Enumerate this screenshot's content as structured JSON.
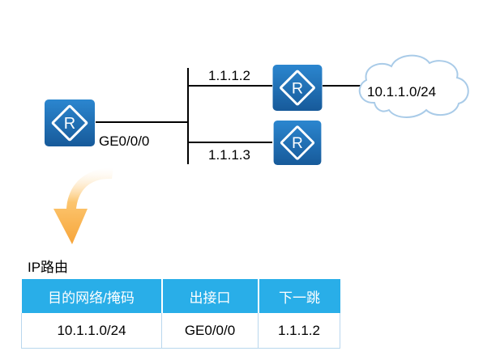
{
  "topology": {
    "interface_label": "GE0/0/0",
    "next_hop_1": "1.1.1.2",
    "next_hop_2": "1.1.1.3",
    "network_label": "10.1.1.0/24"
  },
  "route_table": {
    "caption": "IP路由",
    "columns": [
      "目的网络/掩码",
      "出接口",
      "下一跳"
    ],
    "rows": [
      [
        "10.1.1.0/24",
        "GE0/0/0",
        "1.1.1.2"
      ]
    ]
  },
  "colors": {
    "router_fill": "#1e6fb5",
    "table_header": "#29aee8",
    "arrow": "#fbb04c"
  },
  "icons": {
    "router": "router-icon",
    "cloud": "cloud-icon",
    "arrow": "curved-arrow-icon"
  }
}
